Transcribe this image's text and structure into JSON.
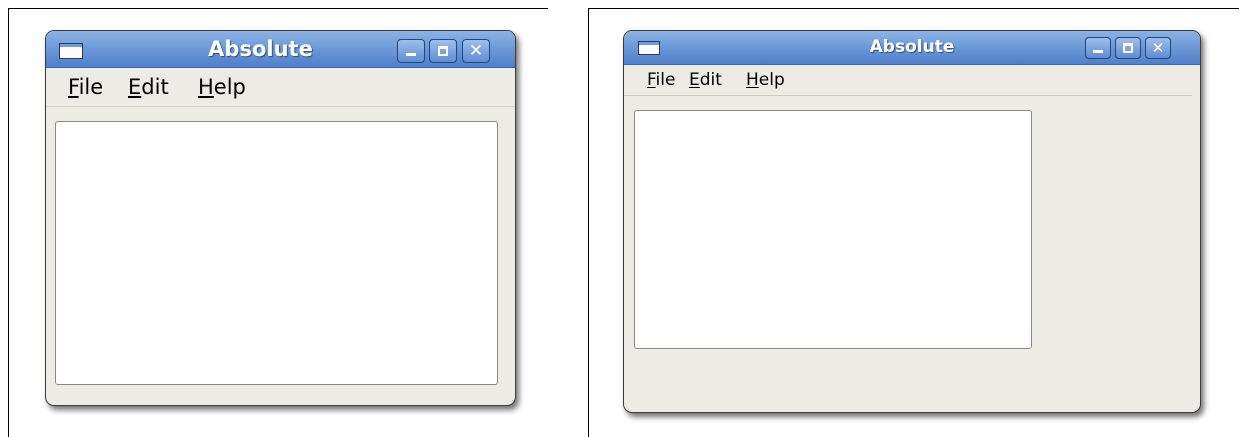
{
  "windows": [
    {
      "id": "left",
      "title": "Absolute",
      "menu": [
        {
          "mnemonic": "F",
          "rest": "ile"
        },
        {
          "mnemonic": "E",
          "rest": "dit"
        },
        {
          "mnemonic": "H",
          "rest": "elp"
        }
      ],
      "buttons": {
        "minimize_icon": "minimize-icon",
        "maximize_icon": "maximize-icon",
        "close_icon": "close-icon",
        "close_glyph": "✕"
      },
      "text_area": {
        "value": ""
      }
    },
    {
      "id": "right",
      "title": "Absolute",
      "menu": [
        {
          "mnemonic": "F",
          "rest": "ile"
        },
        {
          "mnemonic": "E",
          "rest": "dit"
        },
        {
          "mnemonic": "H",
          "rest": "elp"
        }
      ],
      "buttons": {
        "minimize_icon": "minimize-icon",
        "maximize_icon": "maximize-icon",
        "close_icon": "close-icon",
        "close_glyph": "✕"
      },
      "text_area": {
        "value": ""
      }
    }
  ],
  "colors": {
    "titlebar_blue": "#6f9bd9",
    "window_background": "#edebe6",
    "text_area_background": "#ffffff"
  }
}
